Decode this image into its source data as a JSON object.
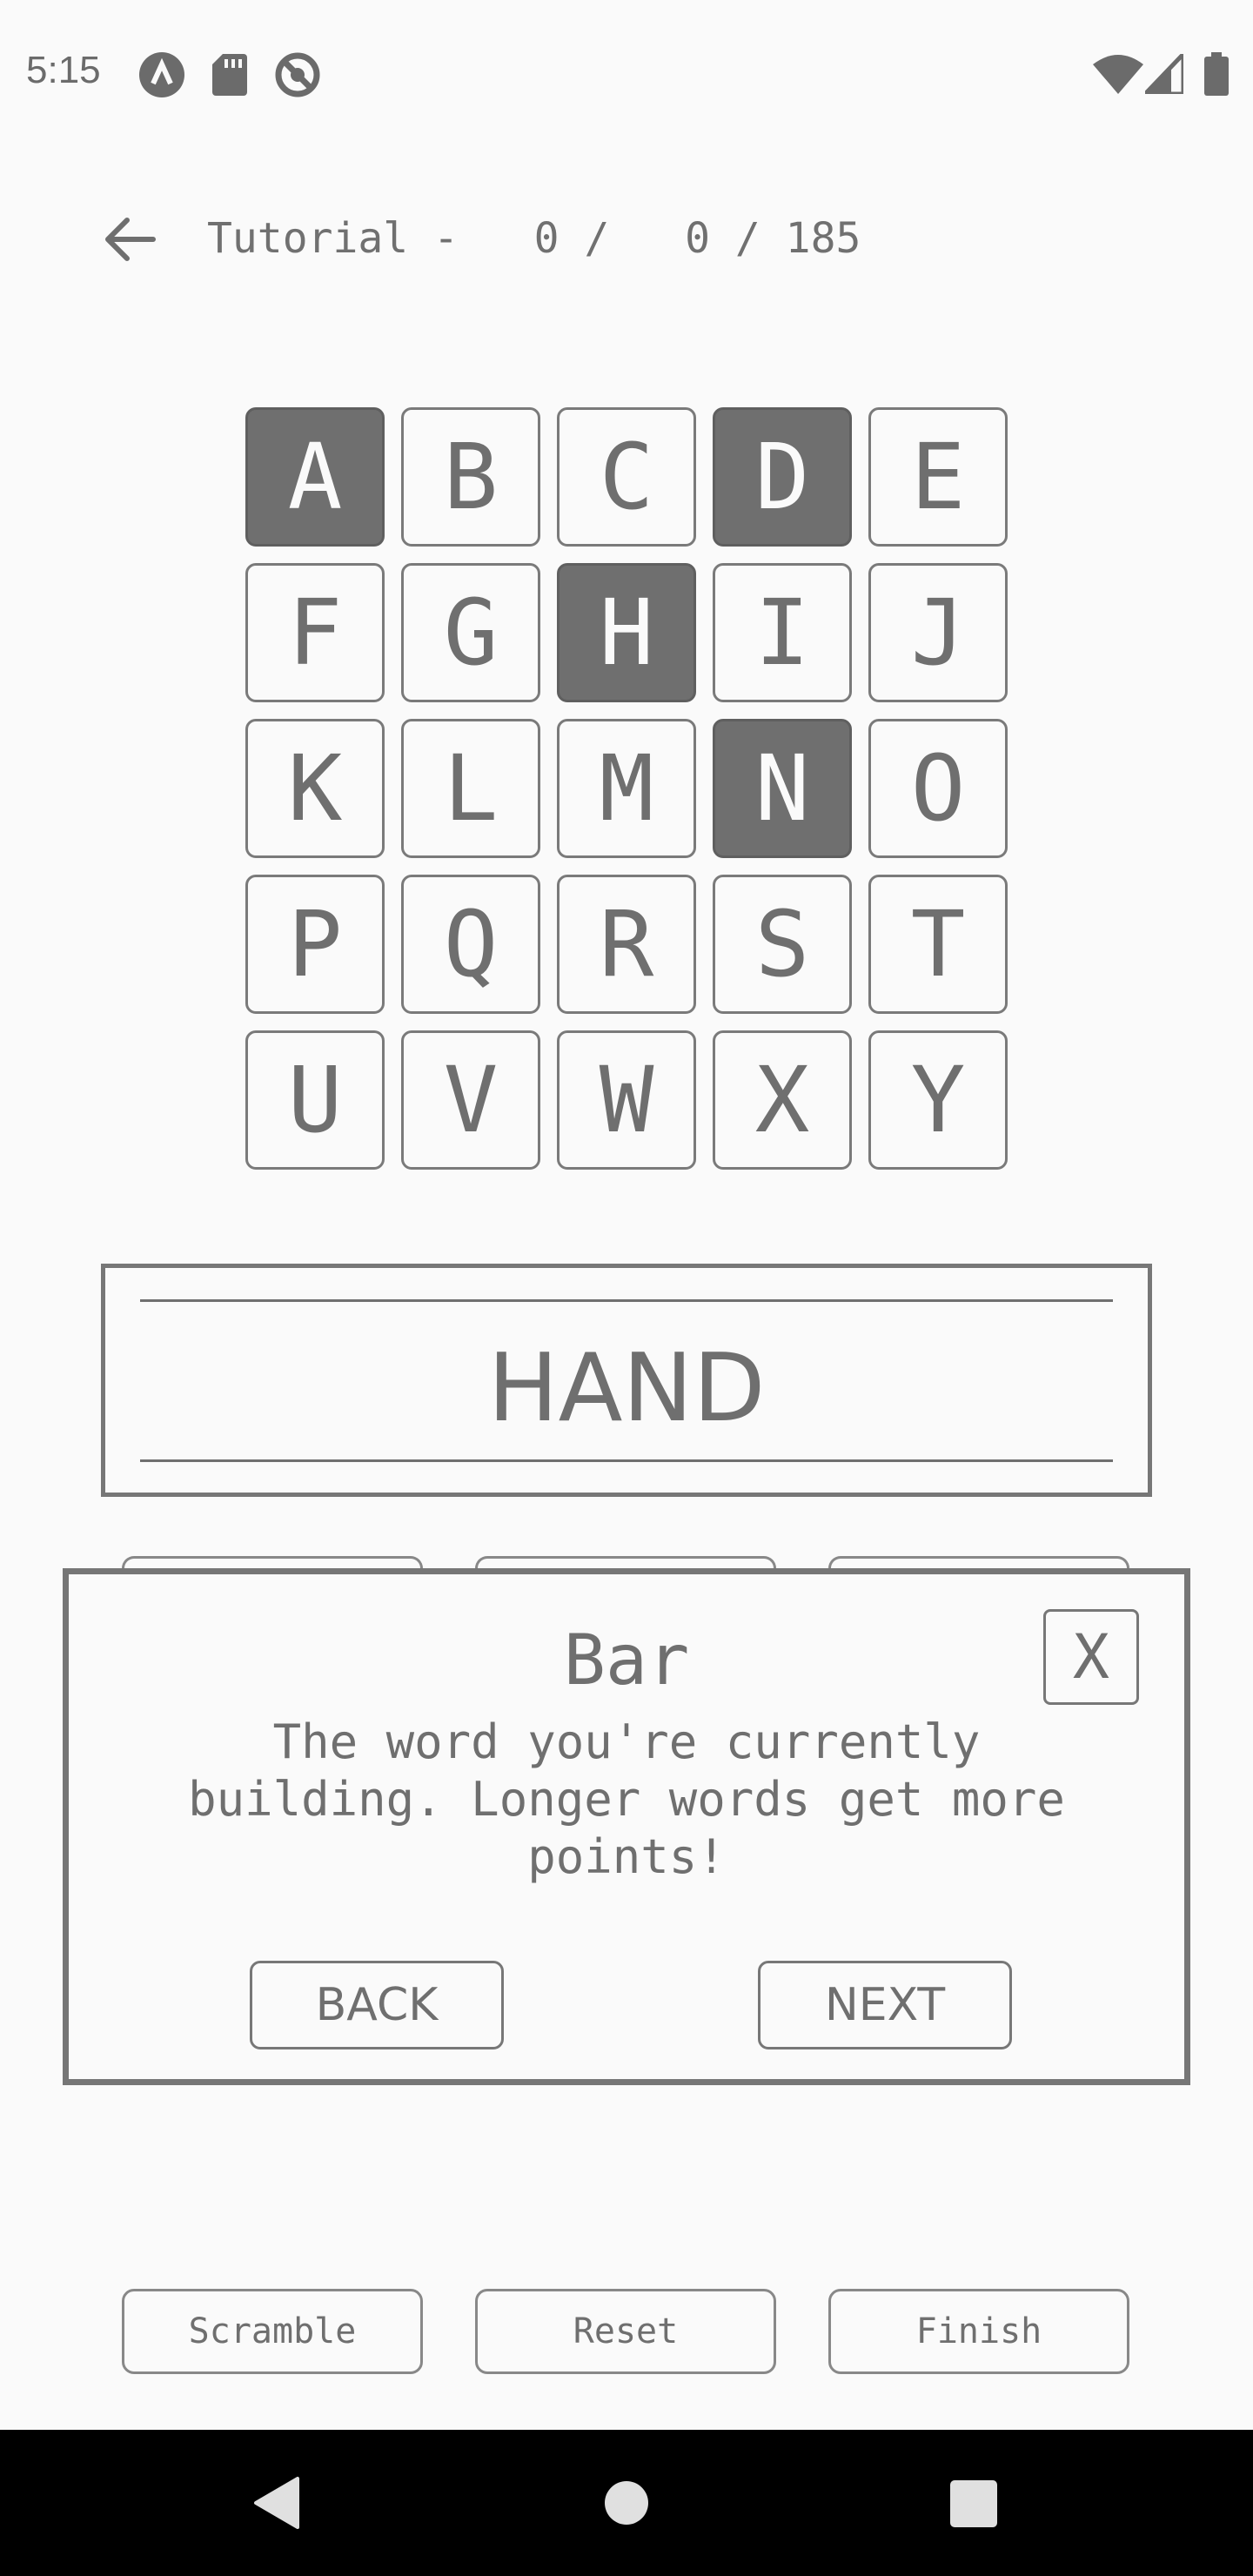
{
  "status_bar": {
    "time": "5:15",
    "left_icons": [
      "app-a-icon",
      "sd-card-icon",
      "no-sync-icon"
    ],
    "right_icons": [
      "wifi-icon",
      "signal-icon",
      "battery-icon"
    ]
  },
  "header": {
    "back_icon": "arrow-left-icon",
    "text": "Tutorial -   0 /   0 / 185"
  },
  "grid": {
    "tiles": [
      {
        "letter": "A",
        "selected": true
      },
      {
        "letter": "B",
        "selected": false
      },
      {
        "letter": "C",
        "selected": false
      },
      {
        "letter": "D",
        "selected": true
      },
      {
        "letter": "E",
        "selected": false
      },
      {
        "letter": "F",
        "selected": false
      },
      {
        "letter": "G",
        "selected": false
      },
      {
        "letter": "H",
        "selected": true
      },
      {
        "letter": "I",
        "selected": false
      },
      {
        "letter": "J",
        "selected": false
      },
      {
        "letter": "K",
        "selected": false
      },
      {
        "letter": "L",
        "selected": false
      },
      {
        "letter": "M",
        "selected": false
      },
      {
        "letter": "N",
        "selected": true
      },
      {
        "letter": "O",
        "selected": false
      },
      {
        "letter": "P",
        "selected": false
      },
      {
        "letter": "Q",
        "selected": false
      },
      {
        "letter": "R",
        "selected": false
      },
      {
        "letter": "S",
        "selected": false
      },
      {
        "letter": "T",
        "selected": false
      },
      {
        "letter": "U",
        "selected": false
      },
      {
        "letter": "V",
        "selected": false
      },
      {
        "letter": "W",
        "selected": false
      },
      {
        "letter": "X",
        "selected": false
      },
      {
        "letter": "Y",
        "selected": false
      }
    ]
  },
  "word_bar": {
    "word": "HAND"
  },
  "popup": {
    "title": "Bar",
    "close_label": "X",
    "body": "The word you're currently building. Longer words get more points!",
    "back_label": "BACK",
    "next_label": "NEXT"
  },
  "bottom_buttons": {
    "scramble": "Scramble",
    "reset": "Reset",
    "finish": "Finish"
  },
  "nav_bar": {
    "back_icon": "nav-back-icon",
    "home_icon": "nav-home-icon",
    "recents_icon": "nav-recents-icon"
  },
  "colors": {
    "background": "#fafafa",
    "foreground": "#6f6f6f",
    "selected_tile": "#6f6f6f",
    "nav_bar": "#000000"
  }
}
